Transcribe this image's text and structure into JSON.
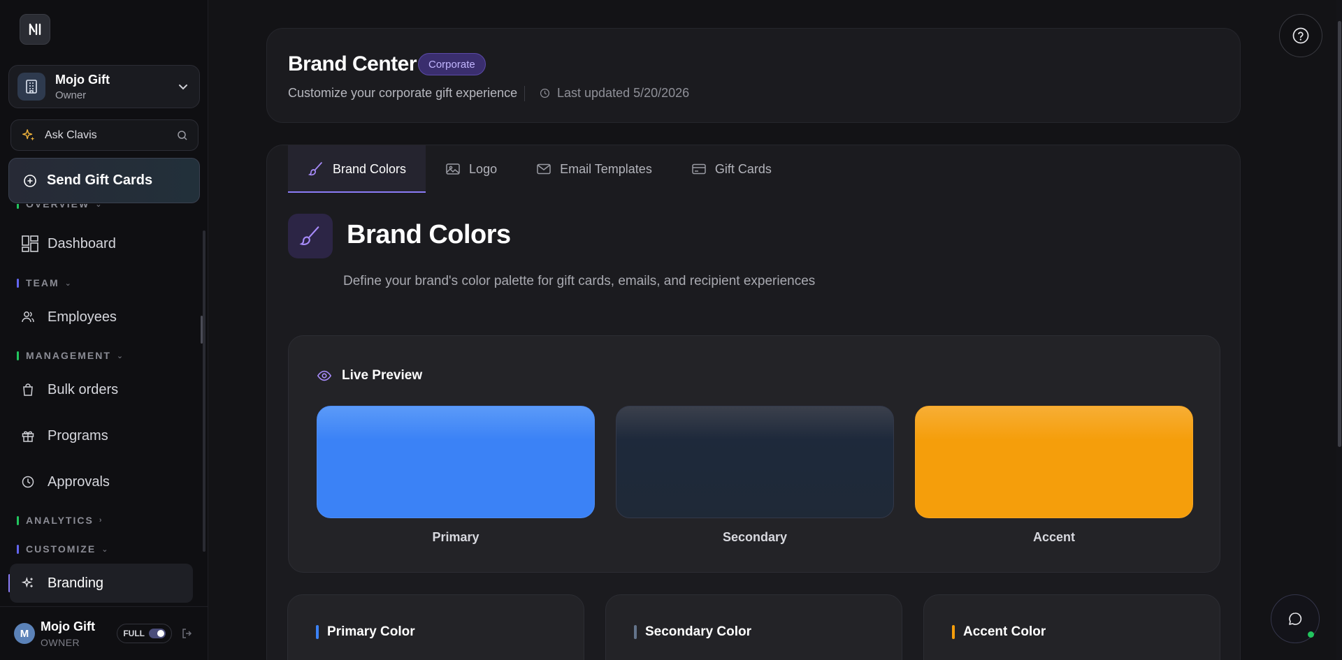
{
  "sidebar": {
    "org": {
      "name": "Mojo Gift",
      "role": "Owner"
    },
    "ask": {
      "label": "Ask Clavis"
    },
    "send_button": {
      "label": "Send Gift Cards"
    },
    "sections": [
      {
        "label": "OVERVIEW",
        "color": "#22c55e"
      },
      {
        "label": "TEAM",
        "color": "#6366f1"
      },
      {
        "label": "MANAGEMENT",
        "color": "#22c55e"
      },
      {
        "label": "ANALYTICS",
        "color": "#22c55e"
      },
      {
        "label": "CUSTOMIZE",
        "color": "#6366f1"
      }
    ],
    "items": [
      {
        "label": "Dashboard",
        "icon": "dashboard-icon"
      },
      {
        "label": "Employees",
        "icon": "users-icon"
      },
      {
        "label": "Bulk orders",
        "icon": "shopping-bag-icon"
      },
      {
        "label": "Programs",
        "icon": "gift-icon"
      },
      {
        "label": "Approvals",
        "icon": "clock-icon"
      },
      {
        "label": "Branding",
        "icon": "sparkles-icon",
        "active": true
      }
    ],
    "user": {
      "initial": "M",
      "name": "Mojo Gift",
      "role": "OWNER",
      "mode": "FULL"
    }
  },
  "header": {
    "title": "Brand Center",
    "badge": "Corporate",
    "subtitle": "Customize your corporate gift experience",
    "updated": "Last updated 5/20/2026"
  },
  "tabs": [
    {
      "label": "Brand Colors",
      "icon": "paintbrush-icon",
      "active": true
    },
    {
      "label": "Logo",
      "icon": "image-icon"
    },
    {
      "label": "Email Templates",
      "icon": "mail-icon"
    },
    {
      "label": "Gift Cards",
      "icon": "credit-card-icon"
    }
  ],
  "section": {
    "title": "Brand Colors",
    "description": "Define your brand's color palette for gift cards, emails, and recipient experiences"
  },
  "preview": {
    "title": "Live Preview",
    "swatches": [
      {
        "label": "Primary",
        "color": "#3b82f6"
      },
      {
        "label": "Secondary",
        "color": "#1e293b"
      },
      {
        "label": "Accent",
        "color": "#f59e0b"
      }
    ]
  },
  "color_cards": [
    {
      "title": "Primary Color",
      "accent": "#3b82f6"
    },
    {
      "title": "Secondary Color",
      "accent": "#64748b"
    },
    {
      "title": "Accent Color",
      "accent": "#f59e0b"
    }
  ],
  "colors": {
    "accent_purple": "#8b7cf6",
    "online_green": "#22c55e"
  }
}
